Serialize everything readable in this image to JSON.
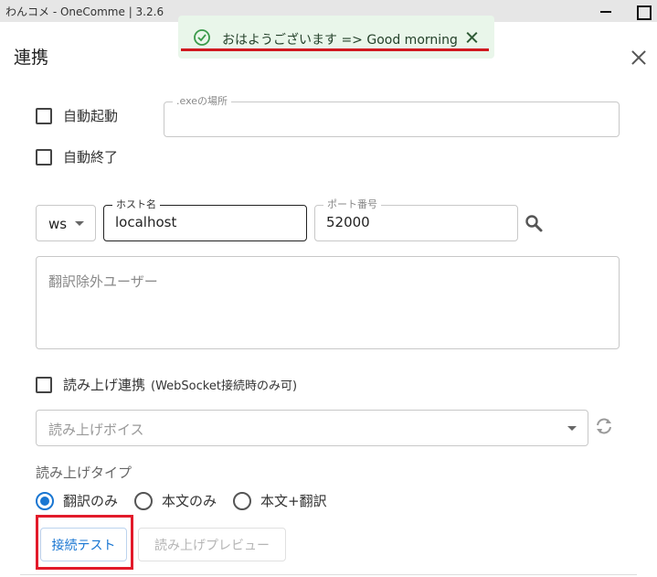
{
  "window": {
    "title": "わんコメ - OneComme | 3.2.6"
  },
  "dialog": {
    "title": "連携",
    "auto_start_label": "自動起動",
    "auto_stop_label": "自動終了",
    "exe_path_label": ".exeの場所",
    "exe_path_value": "",
    "protocol_value": "ws",
    "host_label": "ホスト名",
    "host_value": "localhost",
    "port_label": "ポート番号",
    "port_value": "52000",
    "exclude_users_placeholder": "翻訳除外ユーザー",
    "tts_link_label": "読み上げ連携",
    "tts_link_note": "(WebSocket接続時のみ可)",
    "voice_placeholder": "読み上げボイス",
    "read_type_label": "読み上げタイプ",
    "radio_options": [
      {
        "label": "翻訳のみ",
        "selected": true
      },
      {
        "label": "本文のみ",
        "selected": false
      },
      {
        "label": "本文+翻訳",
        "selected": false
      }
    ],
    "connection_test_label": "接続テスト",
    "preview_label": "読み上げプレビュー"
  },
  "toast": {
    "message": "おはようございます => Good morning",
    "accent": "#3a9a4a"
  },
  "colors": {
    "primary": "#1976d2",
    "highlight_red": "#e21a2a"
  }
}
